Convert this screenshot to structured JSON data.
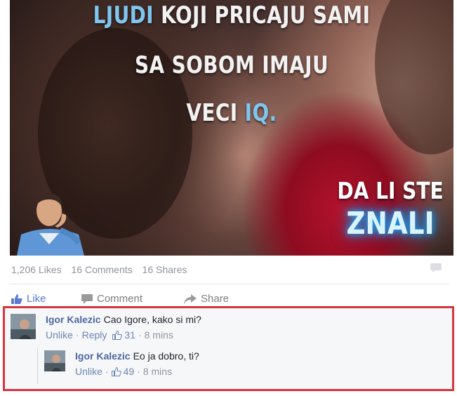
{
  "image": {
    "caption_line1_accent": "LJUDI",
    "caption_line1_rest": "KOJI PRICAJU SAMI",
    "caption_line2": "SA SOBOM IMAJU",
    "caption_line3_main": "VECI",
    "caption_line3_accent": "IQ.",
    "tagline": "DA LI STE",
    "tagline_highlight": "ZNALI",
    "colors": {
      "accent_text": "#7fc6ef",
      "glow": "#1e9be8",
      "dress": "#b3122c"
    }
  },
  "stats": {
    "likes": "1,206 Likes",
    "comments": "16 Comments",
    "shares": "16 Shares"
  },
  "actions": {
    "like_label": "Like",
    "comment_label": "Comment",
    "share_label": "Share"
  },
  "comments": [
    {
      "author": "Igor Kalezic",
      "text": "Cao Igore, kako si mi?",
      "unlike": "Unlike",
      "reply": "Reply",
      "likes": "31",
      "time": "8 mins"
    },
    {
      "author": "Igor Kalezic",
      "text": "Eo ja dobro, ti?",
      "unlike": "Unlike",
      "likes": "49",
      "time": "8 mins"
    }
  ],
  "highlight_color": "#d7353f"
}
